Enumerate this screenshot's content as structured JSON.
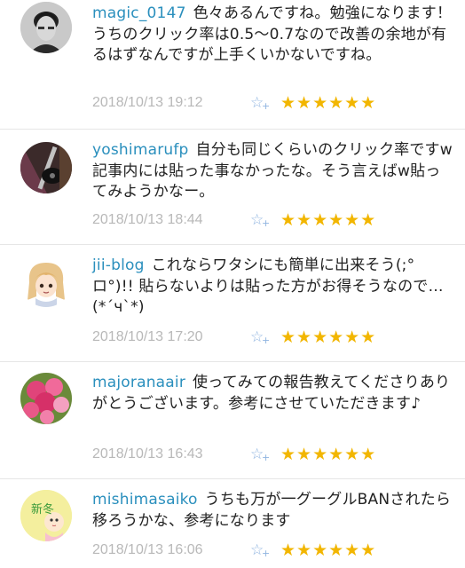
{
  "comments": [
    {
      "username": "magic_0147",
      "text": "色々あるんですね。勉強になります！うちのクリック率は0.5〜0.7なので改善の余地が有るはずなんですが上手くいかないですね。",
      "date": "2018/10/13 19:12",
      "stars": "★★★★★★",
      "avatar_icon": "man-portrait-avatar"
    },
    {
      "username": "yoshimarufp",
      "text": "自分も同じくらいのクリック率ですw記事内には貼った事なかったな。そう言えばw貼ってみようかなー。",
      "date": "2018/10/13 18:44",
      "stars": "★★★★★★",
      "avatar_icon": "guitar-avatar"
    },
    {
      "username": "jii-blog",
      "text": "これならワタシにも簡単に出来そう(;°ロ°)!! 貼らないよりは貼った方がお得そうなので…(*´ч`*)",
      "date": "2018/10/13 17:20",
      "stars": "★★★★★★",
      "avatar_icon": "anime-girl-avatar"
    },
    {
      "username": "majoranaair",
      "text": "使ってみての報告教えてくださりありがとうございます。参考にさせていただきます♪",
      "date": "2018/10/13 16:43",
      "stars": "★★★★★★",
      "avatar_icon": "pink-roses-avatar"
    },
    {
      "username": "mishimasaiko",
      "text": "うちも万が一グーグルBANされたら移ろうかな、参考になります",
      "date": "2018/10/13 16:06",
      "stars": "★★★★★★",
      "avatar_icon": "new-winter-baby-avatar",
      "avatar_text": "新冬"
    }
  ],
  "ui": {
    "fav_icon": "☆",
    "fav_plus": "+"
  }
}
